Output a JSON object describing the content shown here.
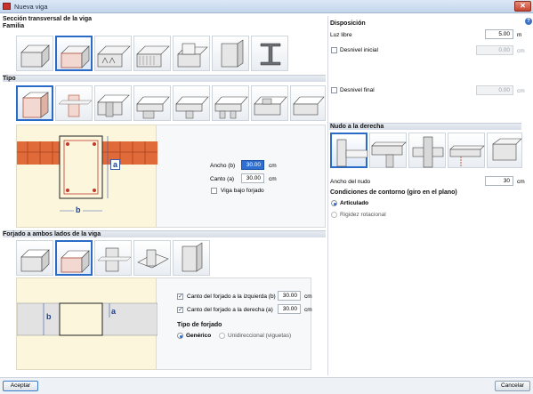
{
  "window": {
    "title": "Nueva viga",
    "close": "✕"
  },
  "help_icon": "?",
  "left": {
    "section_title": "Sección transversal de la viga",
    "familia_label": "Familia",
    "tipo_label": "Tipo",
    "section_dims": {
      "ancho_label": "Ancho (b)",
      "ancho_value": "30.00",
      "ancho_unit": "cm",
      "canto_label": "Canto (a)",
      "canto_value": "30.00",
      "canto_unit": "cm",
      "bajo_forjado_label": "Viga bajo forjado",
      "dim_a": "a",
      "dim_b": "b"
    },
    "forjado_title": "Forjado a ambos lados de la viga",
    "forjado": {
      "izq_label": "Canto del forjado a la izquierda (b)",
      "izq_value": "30.00",
      "izq_unit": "cm",
      "der_label": "Canto del forjado a la derecha (a)",
      "der_value": "30.00",
      "der_unit": "cm",
      "tipo_title": "Tipo de forjado",
      "generico": "Genérico",
      "unidireccional": "Unidireccional (viguetas)",
      "dim_a": "a",
      "dim_b": "b"
    }
  },
  "right": {
    "disposicion_title": "Disposición",
    "luz_libre_label": "Luz libre",
    "luz_libre_value": "5.00",
    "luz_libre_unit": "m",
    "desnivel_inicial_label": "Desnivel inicial",
    "desnivel_inicial_value": "0.00",
    "desnivel_inicial_unit": "cm",
    "desnivel_final_label": "Desnivel final",
    "desnivel_final_value": "0.00",
    "desnivel_final_unit": "cm",
    "nudo_title": "Nudo a la derecha",
    "ancho_nudo_label": "Ancho del nudo",
    "ancho_nudo_value": "30",
    "ancho_nudo_unit": "cm",
    "contorno_title": "Condiciones de contorno (giro en el plano)",
    "articulado": "Articulado",
    "rigidez": "Rigidez rotacional"
  },
  "footer": {
    "accept": "Aceptar",
    "cancel": "Cancelar"
  },
  "colors": {
    "accent": "#2a6bc8",
    "brick": "#d9582b",
    "diagram_bg": "#fbf6dc"
  }
}
